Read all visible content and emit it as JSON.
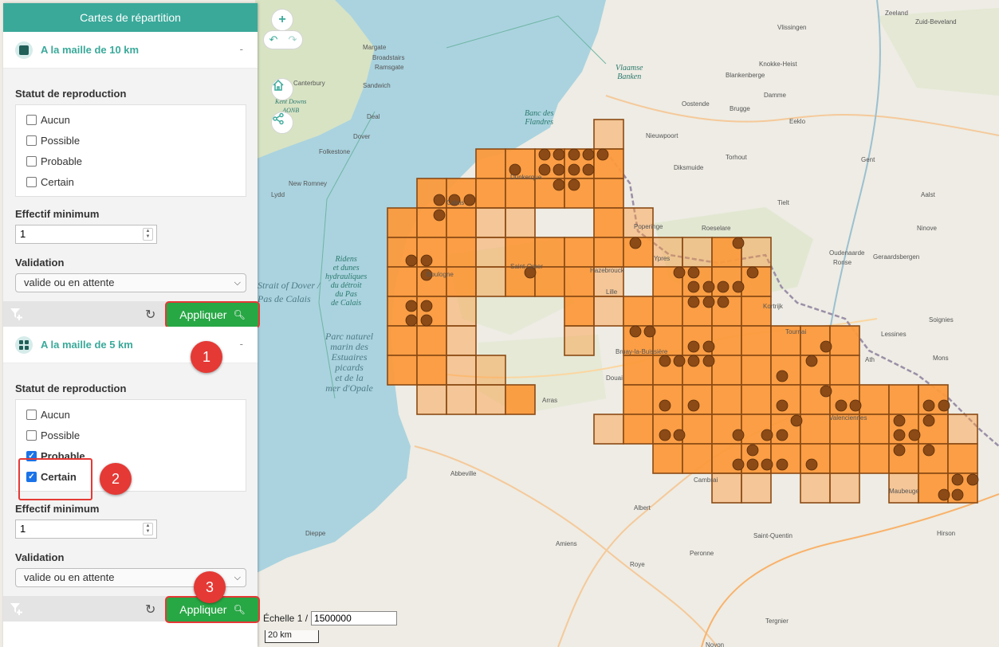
{
  "panel": {
    "title": "Cartes de répartition",
    "sections": [
      {
        "title": "A la maille de 10 km",
        "collapse_symbol": "-",
        "statut_label": "Statut de reproduction",
        "statuts": [
          {
            "label": "Aucun",
            "checked": false
          },
          {
            "label": "Possible",
            "checked": false
          },
          {
            "label": "Probable",
            "checked": false
          },
          {
            "label": "Certain",
            "checked": false
          }
        ],
        "effectif_label": "Effectif minimum",
        "effectif_value": "1",
        "validation_label": "Validation",
        "validation_value": "valide ou en attente",
        "apply_label": "Appliquer"
      },
      {
        "title": "A la maille de 5 km",
        "collapse_symbol": "-",
        "statut_label": "Statut de reproduction",
        "statuts": [
          {
            "label": "Aucun",
            "checked": false
          },
          {
            "label": "Possible",
            "checked": false
          },
          {
            "label": "Probable",
            "checked": true
          },
          {
            "label": "Certain",
            "checked": true
          }
        ],
        "effectif_label": "Effectif minimum",
        "effectif_value": "1",
        "validation_label": "Validation",
        "validation_value": "valide ou en attente",
        "apply_label": "Appliquer"
      }
    ]
  },
  "callouts": [
    "1",
    "2",
    "3"
  ],
  "map_controls": {
    "zoom_in": "+",
    "zoom_out": "-",
    "undo": "↶",
    "redo": "↷"
  },
  "scale": {
    "label": "Échelle 1 /",
    "value": "1500000",
    "bar_label": "20 km"
  },
  "map_labels": {
    "sea": {
      "dover": "Strait of Dover /",
      "pas_de_calais": "Pas de Calais",
      "ridens": "Ridens\net dunes\nhydrauliques\ndu détroit\ndu Pas\nde Calais",
      "parc_marin": "Parc naturel\nmarin des\nEstuaires\npicards\net de la\nmer d'Opale",
      "vlaamse": "Vlaamse\nBanken",
      "banc": "Banc des\nFlandres",
      "kent": "Kent Downs\nAONB"
    },
    "places": [
      "Canterbury",
      "Margate",
      "Broadstairs",
      "Ramsgate",
      "Sandwich",
      "Deal",
      "Dover",
      "Folkestone",
      "New Romney",
      "Lydd",
      "Vlissingen",
      "Zeeland",
      "Zuid-Beveland",
      "Oostende",
      "Brugge",
      "Blankenberge",
      "Knokke-Heist",
      "Damme",
      "Gent",
      "Eeklo",
      "Nieuwpoort",
      "Diksmuide",
      "Torhout",
      "Tielt",
      "Roeselare",
      "Kortrijk",
      "Poperinge",
      "Ypres",
      "Dunkerque",
      "Calais",
      "Boulogne",
      "Saint-Omer",
      "Lille",
      "Tournai",
      "Mons",
      "Arras",
      "Douai",
      "Valenciennes",
      "Cambrai",
      "Amiens",
      "Abbeville",
      "Albert",
      "Peronne",
      "Saint-Quentin",
      "Roye",
      "Noyon",
      "Tergnier",
      "Hirson",
      "Dieppe",
      "Maubeuge",
      "Oudenaarde",
      "Aalst",
      "Ninove",
      "Geraardsbergen",
      "Ronse",
      "Lessines",
      "Ath",
      "Soignies",
      "Bruay-la-Buissière",
      "Hazebrouck"
    ]
  },
  "colors": {
    "accent": "#3aa99a",
    "apply": "#28a745",
    "callout": "#e53935",
    "cell_fill": "#fb9a3c",
    "cell_border": "#8a4a14",
    "dot": "#8b4a16",
    "sea": "#aad3df",
    "land": "#f2efe9"
  }
}
